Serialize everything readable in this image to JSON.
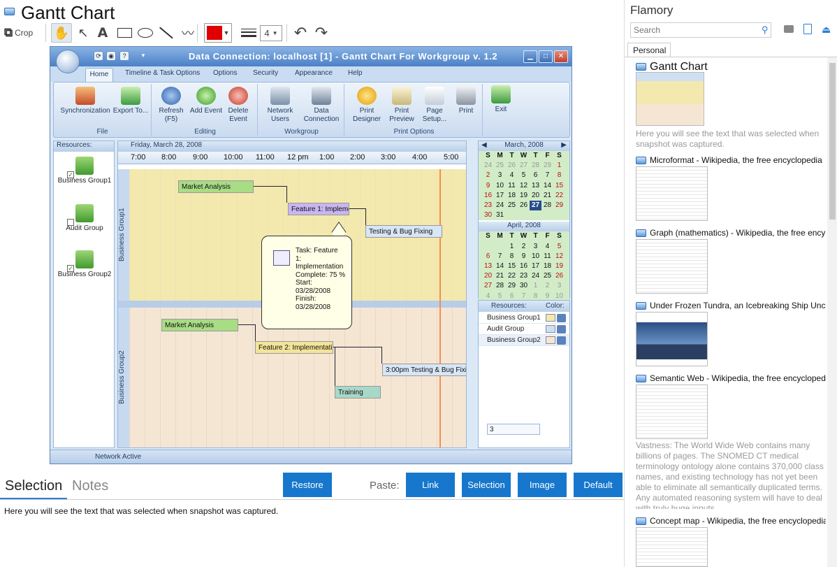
{
  "window": {
    "title": "Gantt Chart"
  },
  "toolbar": {
    "crop_label": "Crop",
    "line_width": "4",
    "color": "#e00000"
  },
  "screenshot": {
    "window_title": "Data Connection: localhost [1] - Gantt Chart For Workgroup v. 1.2",
    "tabs": [
      "Home",
      "Timeline & Task Options",
      "Options",
      "Security",
      "Appearance",
      "Help"
    ],
    "ribbon": {
      "groups": [
        "File",
        "Editing",
        "Workgroup",
        "Print Options"
      ],
      "buttons": [
        "Synchronization",
        "Export To...",
        "Refresh (F5)",
        "Add Event",
        "Delete Event",
        "Network Users",
        "Data Connection",
        "Print Designer",
        "Print Preview",
        "Page Setup...",
        "Print",
        "Exit"
      ]
    },
    "resources_header": "Resources:",
    "resources": [
      "Business Group1",
      "Audit Group",
      "Business Group2"
    ],
    "date_header": "Friday, March 28, 2008",
    "hours": [
      "7:00",
      "8:00",
      "9:00",
      "10:00",
      "11:00",
      "12 pm",
      "1:00",
      "2:00",
      "3:00",
      "4:00",
      "5:00"
    ],
    "group_labels": [
      "Business Group1",
      "Business Group2"
    ],
    "tasks": [
      "Market Analysis",
      "Feature 1: Impleme",
      "Testing & Bug Fixing",
      "Market Analysis",
      "Feature 2: Implementati",
      "3:00pm Testing & Bug Fixir",
      "Training"
    ],
    "tooltip": [
      "Task: Feature",
      "1:",
      "Implementation",
      "Complete: 75 %",
      "Start:",
      "03/28/2008",
      "Finish:",
      "03/28/2008"
    ],
    "calendar1": {
      "title": "March, 2008",
      "days": [
        "S",
        "M",
        "T",
        "W",
        "T",
        "F",
        "S"
      ],
      "cells": [
        "24",
        "25",
        "26",
        "27",
        "28",
        "29",
        "1",
        "2",
        "3",
        "4",
        "5",
        "6",
        "7",
        "8",
        "9",
        "10",
        "11",
        "12",
        "13",
        "14",
        "15",
        "16",
        "17",
        "18",
        "19",
        "20",
        "21",
        "22",
        "23",
        "24",
        "25",
        "26",
        "27",
        "28",
        "29",
        "30",
        "31"
      ]
    },
    "calendar2": {
      "title": "April, 2008",
      "cells": [
        "",
        "",
        "1",
        "2",
        "3",
        "4",
        "5",
        "6",
        "7",
        "8",
        "9",
        "10",
        "11",
        "12",
        "13",
        "14",
        "15",
        "16",
        "17",
        "18",
        "19",
        "20",
        "21",
        "22",
        "23",
        "24",
        "25",
        "26",
        "27",
        "28",
        "29",
        "30",
        "1",
        "2",
        "3",
        "4",
        "5",
        "6",
        "7",
        "8",
        "9",
        "10"
      ]
    },
    "resgrid": {
      "col1": "Resources:",
      "col2": "Color:",
      "rows": [
        "Business Group1",
        "Audit Group",
        "Business Group2"
      ],
      "search": "3"
    },
    "status": "Network Active"
  },
  "bottom": {
    "tab_selection": "Selection",
    "tab_notes": "Notes",
    "restore": "Restore",
    "paste_label": "Paste:",
    "link": "Link",
    "selection": "Selection",
    "image": "Image",
    "default": "Default",
    "text": "Here you will see the text that was selected when snapshot was captured."
  },
  "sidebar": {
    "title": "Flamory",
    "search_placeholder": "Search",
    "tab": "Personal",
    "entries": [
      {
        "title": "Gantt Chart",
        "desc": "Here you will see the text that was selected when snapshot was captured."
      },
      {
        "title": "Microformat - Wikipedia, the free encyclopedia"
      },
      {
        "title": "Graph (mathematics) - Wikipedia, the free ency"
      },
      {
        "title": "Under Frozen Tundra, an Icebreaking Ship Unco"
      },
      {
        "title": "Semantic Web - Wikipedia, the free encycloped",
        "desc": "Vastness: The World Wide Web contains many billions of pages. The SNOMED CT medical terminology ontology alone contains 370,000 class names, and existing technology has not yet been able to eliminate all semantically duplicated terms. Any automated reasoning system will have to deal with truly huge inputs."
      },
      {
        "title": "Concept map - Wikipedia, the free encyclopedia"
      }
    ]
  }
}
